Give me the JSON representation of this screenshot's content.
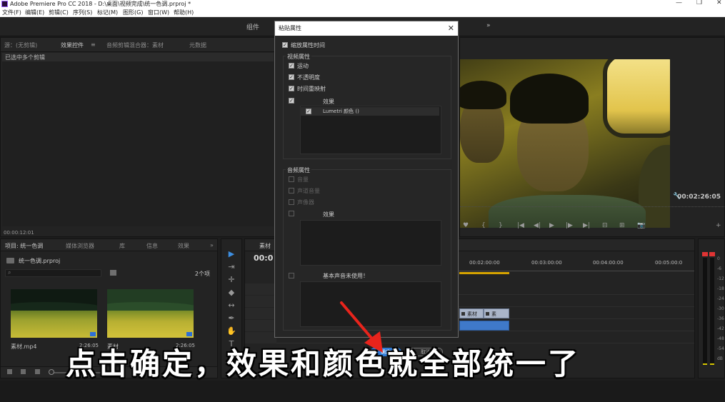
{
  "window": {
    "title": "Adobe Premiere Pro CC 2018 - D:\\桌面\\视频完成\\统一色调.prproj *",
    "minimize": "—",
    "restore": "❐",
    "close": "✕"
  },
  "menu": [
    "文件(F)",
    "编辑(E)",
    "剪辑(C)",
    "序列(S)",
    "标记(M)",
    "图形(G)",
    "窗口(W)",
    "帮助(H)"
  ],
  "workspace": {
    "tabs": [
      "组件"
    ],
    "more": "»"
  },
  "effect_controls": {
    "tabs": [
      "源：(无剪辑)",
      "效果控件",
      "音频剪辑混合器：素材",
      "元数据"
    ],
    "menu_icon": "≡",
    "subhead": "已选中多个剪辑",
    "timecode": "00:00:12:01"
  },
  "project": {
    "tabs": [
      "项目: 统一色调",
      "媒体浏览器",
      "库",
      "信息",
      "效果"
    ],
    "more": "»",
    "file": "统一色调.prproj",
    "search_icon": "⌕",
    "count": "2个项",
    "items": [
      {
        "name": "素材.mp4",
        "duration": "2:26:05"
      },
      {
        "name": "素材",
        "duration": "2:26:05"
      }
    ]
  },
  "tools": [
    "▶",
    "⇥",
    "✛",
    "◆",
    "↔",
    "✒",
    "✋",
    "T"
  ],
  "timeline": {
    "tab": "素材",
    "timecode": "00:0",
    "ruler": [
      "00:02:00:00",
      "00:03:00:00",
      "00:04:00:00",
      "00:05:00:0"
    ],
    "clips": {
      "v1": [
        "素材",
        "素材.mp"
      ]
    }
  },
  "program": {
    "timecode": "00:02:26:05",
    "wrench_icon": "🔧",
    "controls": [
      "♥",
      "{",
      "}",
      "|◀",
      "◀|",
      "▶",
      "|▶",
      "▶|",
      "⊟",
      "⊞",
      "📷",
      "+"
    ]
  },
  "meter": {
    "scale": [
      "0",
      "-6",
      "-12",
      "-18",
      "-24",
      "-30",
      "-36",
      "-42",
      "-48",
      "-54",
      "dB"
    ]
  },
  "dialog": {
    "title": "粘贴属性",
    "close_icon": "✕",
    "scale_attr": "缩放属性时间",
    "video_group": "视频属性",
    "video_items": [
      "运动",
      "不透明度",
      "时间重映射"
    ],
    "effects_label": "效果",
    "lumetri": "Lumetri 颜色 ()",
    "audio_group": "音频属性",
    "audio_items": [
      "音量",
      "声道音量",
      "声像器"
    ],
    "audio_effects_label": "效果",
    "essential_sound": "基本声音未使用！",
    "ok": "确定",
    "cancel": "取消"
  },
  "caption": "点击确定，效果和颜色就全部统一了",
  "colors": {
    "accent_blue": "#2e7ad6",
    "arrow_red": "#e8241c",
    "work_area": "#d6a300"
  }
}
